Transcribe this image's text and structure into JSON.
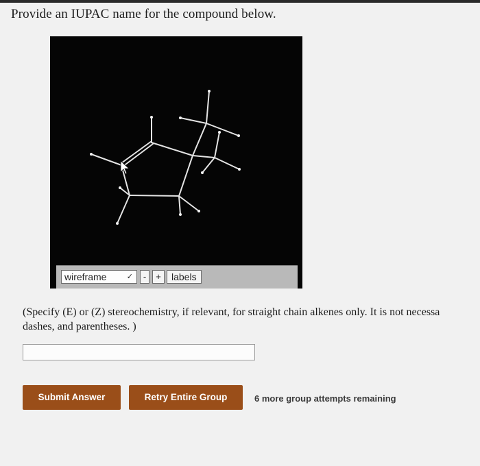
{
  "question": "Provide an IUPAC name for the compound below.",
  "viewer": {
    "style_select_value": "wireframe",
    "zoom_out_label": "-",
    "zoom_in_label": "+",
    "labels_label": "labels"
  },
  "instruction": {
    "line1": "(Specify (E) or (Z) stereochemistry, if relevant, for straight chain alkenes only. It is not necessa",
    "line2": "dashes, and parentheses. )"
  },
  "answer_input": {
    "value": "",
    "placeholder": ""
  },
  "buttons": {
    "submit": "Submit Answer",
    "retry": "Retry Entire Group"
  },
  "attempts_text": "6 more group attempts remaining",
  "colors": {
    "button_bg": "#9a4e19",
    "viewer_bg": "#050505",
    "bond": "#e4e4e4"
  },
  "icons": {
    "select_chevron": "chevron-down-icon",
    "cursor": "mouse-cursor-icon"
  }
}
